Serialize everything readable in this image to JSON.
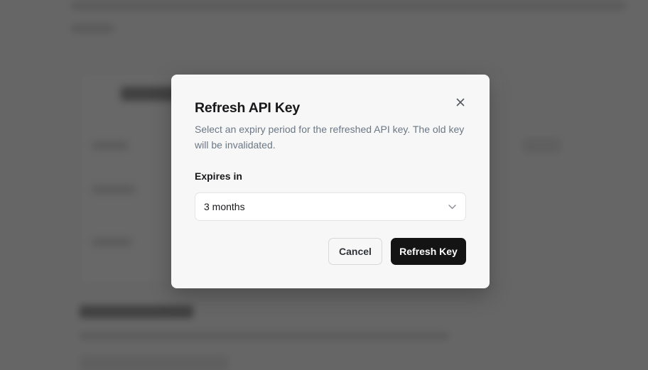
{
  "dialog": {
    "title": "Refresh API Key",
    "description": "Select an expiry period for the refreshed API key. The old key will be invalidated.",
    "close_icon": "close-icon",
    "field": {
      "label": "Expires in",
      "selected_value": "3 months",
      "chevron_icon": "chevron-down-icon"
    },
    "cancel_label": "Cancel",
    "confirm_label": "Refresh Key"
  },
  "colors": {
    "primary_button": "#141414",
    "overlay": "rgba(0,0,0,0.58)",
    "description_text": "#6b7785"
  }
}
